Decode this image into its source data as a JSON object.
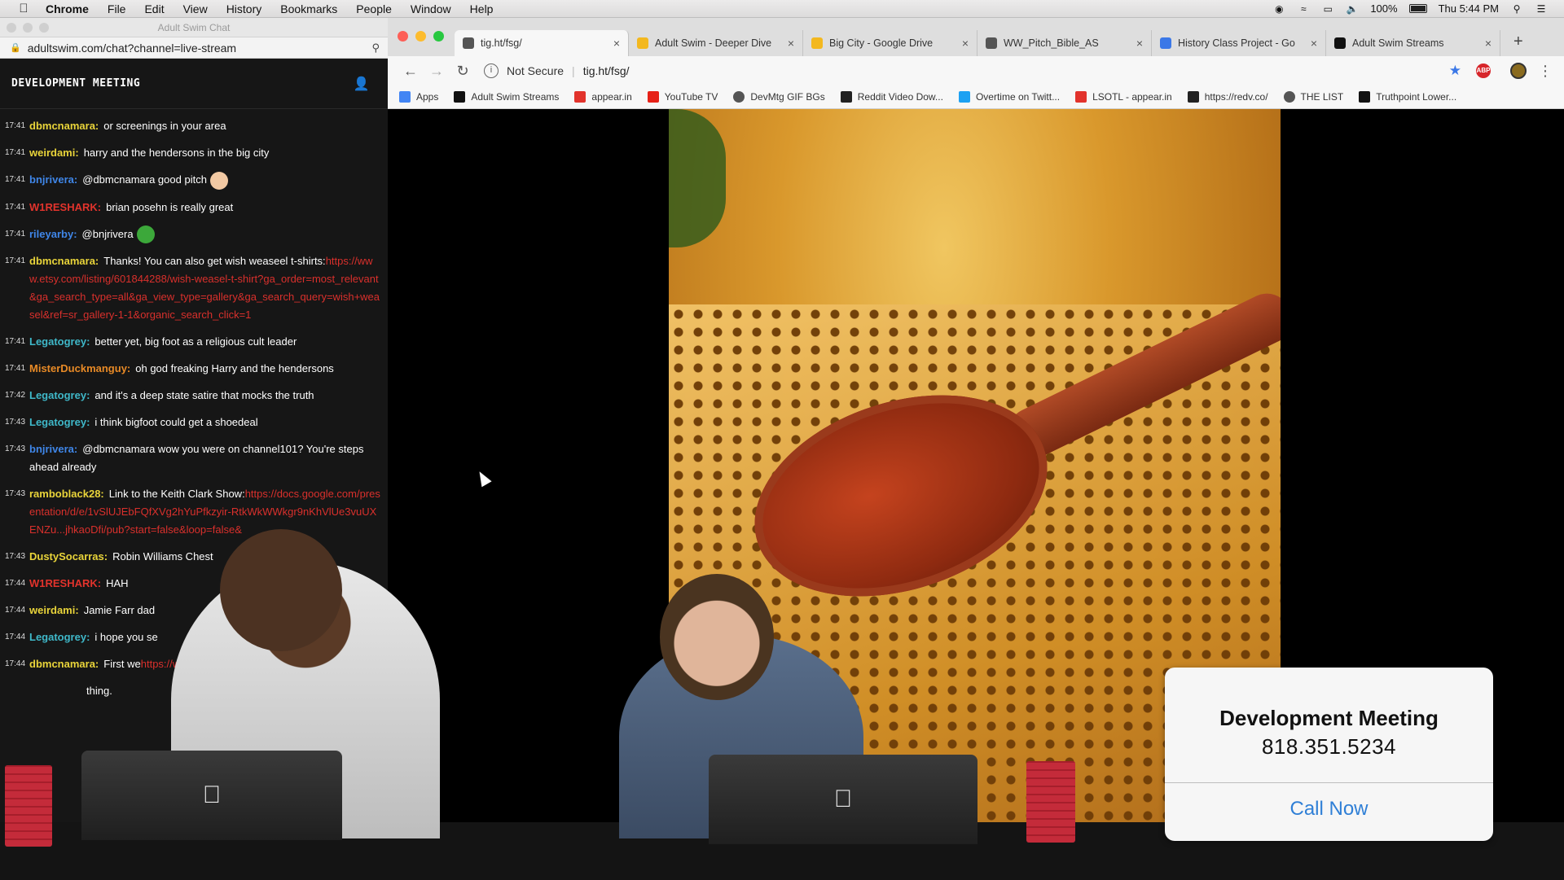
{
  "menubar": {
    "apple": "",
    "app": "Chrome",
    "items": [
      "File",
      "Edit",
      "View",
      "History",
      "Bookmarks",
      "People",
      "Window",
      "Help"
    ],
    "battery": "100%",
    "clock": "Thu 5:44 PM"
  },
  "chat_window": {
    "title": "Adult Swim Chat",
    "url": "adultswim.com/chat?channel=live-stream",
    "header": "DEVELOPMENT MEETING",
    "messages": [
      {
        "time": "17:41",
        "user": "dbmcnamara:",
        "color": "#e9d43a",
        "text": "or screenings in your area",
        "link": ""
      },
      {
        "time": "17:41",
        "user": "weirdami:",
        "color": "#e9d43a",
        "text": "harry and the hendersons in the big city",
        "link": ""
      },
      {
        "time": "17:41",
        "user": "bnjrivera:",
        "color": "#3f86e8",
        "text": "@dbmcnamara good pitch",
        "link": ""
      },
      {
        "time": "17:41",
        "user": "W1RESHARK:",
        "color": "#e2332c",
        "text": "brian posehn is really great",
        "link": ""
      },
      {
        "time": "17:41",
        "user": "rileyarby:",
        "color": "#3f86e8",
        "text": "@bnjrivera",
        "link": ""
      },
      {
        "time": "17:41",
        "user": "dbmcnamara:",
        "color": "#e9d43a",
        "text": "Thanks! You can also get wish weaseel t-shirts:",
        "link": "https://www.etsy.com/listing/601844288/wish-weasel-t-shirt?ga_order=most_relevant&ga_search_type=all&ga_view_type=gallery&ga_search_query=wish+weasel&ref=sr_gallery-1-1&organic_search_click=1"
      },
      {
        "time": "17:41",
        "user": "Legatogrey:",
        "color": "#3fb8c9",
        "text": "better yet, big foot as a religious cult leader",
        "link": ""
      },
      {
        "time": "17:41",
        "user": "MisterDuckmanguy:",
        "color": "#e88a26",
        "text": "oh god freaking Harry and the hendersons",
        "link": ""
      },
      {
        "time": "17:42",
        "user": "Legatogrey:",
        "color": "#3fb8c9",
        "text": "and it's a deep state satire that mocks the truth",
        "link": ""
      },
      {
        "time": "17:43",
        "user": "Legatogrey:",
        "color": "#3fb8c9",
        "text": "i think bigfoot could get a shoedeal",
        "link": ""
      },
      {
        "time": "17:43",
        "user": "bnjrivera:",
        "color": "#3f86e8",
        "text": "@dbmcnamara wow you were on channel101? You're steps ahead already",
        "link": ""
      },
      {
        "time": "17:43",
        "user": "ramboblack28:",
        "color": "#e9d43a",
        "text": "Link to the Keith Clark Show:",
        "link": "https://docs.google.com/presentation/d/e/1vSlUJEbFQfXVg2hYuPfkzyir-RtkWkWWkgr9nKhVlUe3vuUXENZu...jhkaoDfi/pub?start=false&loop=false&"
      },
      {
        "time": "17:43",
        "user": "DustySocarras:",
        "color": "#e9d43a",
        "text": "Robin Williams Chest",
        "link": ""
      },
      {
        "time": "17:44",
        "user": "W1RESHARK:",
        "color": "#e2332c",
        "text": "HAH",
        "link": ""
      },
      {
        "time": "17:44",
        "user": "weirdami:",
        "color": "#e9d43a",
        "text": "Jamie Farr dad",
        "link": ""
      },
      {
        "time": "17:44",
        "user": "Legatogrey:",
        "color": "#3fb8c9",
        "text": "i hope you se",
        "link": ""
      },
      {
        "time": "17:44",
        "user": "dbmcnamara:",
        "color": "#e9d43a",
        "text": "First we",
        "link": "https://www.youtube"
      }
    ],
    "trailing_text": "thing."
  },
  "browser": {
    "tabs": [
      {
        "label": "tig.ht/fsg/",
        "icon": "globe-icon",
        "active": true
      },
      {
        "label": "Adult Swim - Deeper Dive",
        "icon": "drive-icon",
        "active": false
      },
      {
        "label": "Big City - Google Drive",
        "icon": "drive-icon",
        "active": false
      },
      {
        "label": "WW_Pitch_Bible_AS",
        "icon": "globe-icon",
        "active": false
      },
      {
        "label": "History Class Project - Go",
        "icon": "docs-icon",
        "active": false
      },
      {
        "label": "Adult Swim Streams",
        "icon": "as-icon",
        "active": false
      }
    ],
    "new_tab": "+",
    "omnibox": {
      "security": "Not Secure",
      "url": "tig.ht/fsg/"
    },
    "bookmarks": [
      {
        "label": "Apps",
        "icon": "apps-grid-icon"
      },
      {
        "label": "Adult Swim Streams",
        "icon": "as-icon"
      },
      {
        "label": "appear.in",
        "icon": "appearin-icon"
      },
      {
        "label": "YouTube TV",
        "icon": "youtube-icon"
      },
      {
        "label": "DevMtg GIF BGs",
        "icon": "globe-icon"
      },
      {
        "label": "Reddit Video Dow...",
        "icon": "page-icon"
      },
      {
        "label": "Overtime on Twitt...",
        "icon": "twitter-icon"
      },
      {
        "label": "LSOTL - appear.in",
        "icon": "appearin-icon"
      },
      {
        "label": "https://redv.co/",
        "icon": "page-icon"
      },
      {
        "label": "THE LIST",
        "icon": "globe-icon"
      },
      {
        "label": "Truthpoint Lower...",
        "icon": "as-icon"
      }
    ]
  },
  "call_card": {
    "title": "Development Meeting",
    "phone": "818.351.5234",
    "button": "Call Now"
  },
  "colors": {
    "link": "#d9302c",
    "call_button": "#2f7fd6",
    "star": "#3b78e7"
  }
}
